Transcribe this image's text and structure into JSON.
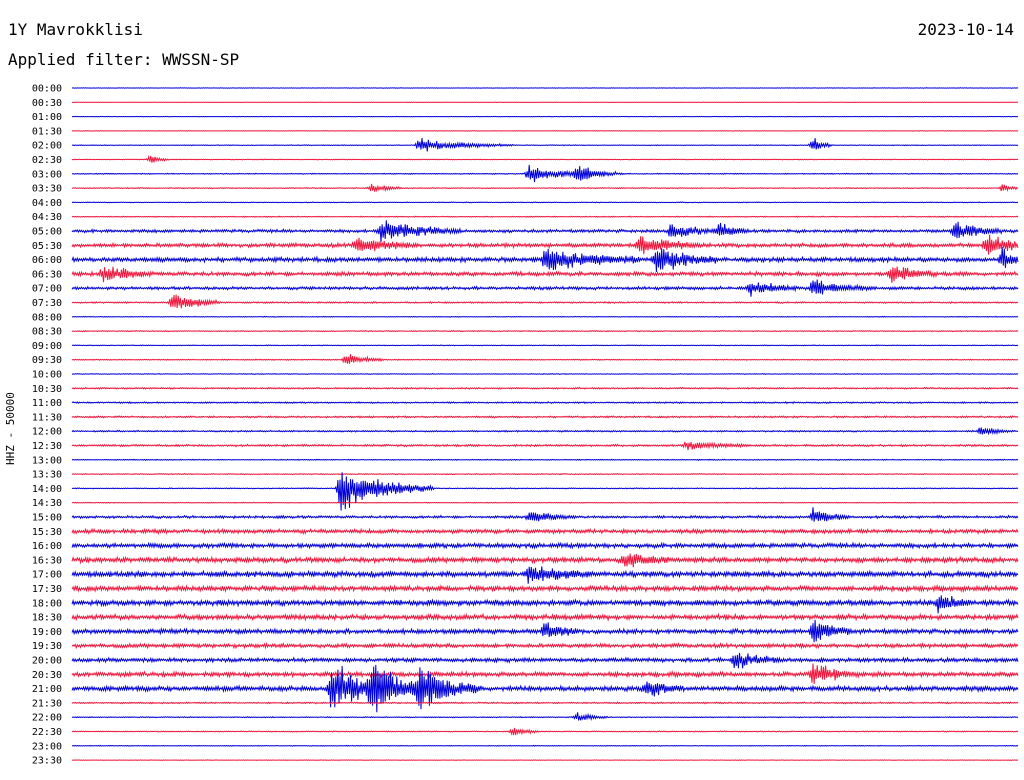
{
  "header": {
    "station": "1Y Mavrokklisi",
    "date": "2023-10-14",
    "filter": "Applied filter: WWSSN-SP"
  },
  "chart_data": {
    "type": "line",
    "title": "1Y Mavrokklisi",
    "ylabel": "HHZ - 50000",
    "trace_times": [
      "00:00",
      "00:30",
      "01:00",
      "01:30",
      "02:00",
      "02:30",
      "03:00",
      "03:30",
      "04:00",
      "04:30",
      "05:00",
      "05:30",
      "06:00",
      "06:30",
      "07:00",
      "07:30",
      "08:00",
      "08:30",
      "09:00",
      "09:30",
      "10:00",
      "10:30",
      "11:00",
      "11:30",
      "12:00",
      "12:30",
      "13:00",
      "13:30",
      "14:00",
      "14:30",
      "15:00",
      "15:30",
      "16:00",
      "16:30",
      "17:00",
      "17:30",
      "18:00",
      "18:30",
      "19:00",
      "19:30",
      "20:00",
      "20:30",
      "21:00",
      "21:30",
      "22:00",
      "22:30",
      "23:00",
      "23:30"
    ],
    "colors": [
      "#0000d8",
      "#f0163c"
    ],
    "noise_level": [
      0.2,
      0.2,
      0.2,
      0.2,
      0.3,
      0.3,
      0.4,
      0.4,
      0.3,
      0.4,
      1.2,
      1.6,
      1.8,
      1.6,
      1.2,
      0.6,
      0.3,
      0.4,
      0.3,
      0.4,
      0.3,
      0.6,
      0.6,
      0.7,
      0.6,
      0.8,
      0.4,
      0.4,
      0.4,
      0.3,
      1.0,
      1.6,
      1.8,
      2.0,
      2.2,
      2.0,
      2.2,
      2.0,
      1.8,
      1.6,
      1.6,
      1.8,
      2.0,
      0.6,
      0.4,
      0.4,
      0.3,
      0.2
    ],
    "events": [
      {
        "trace": "02:00",
        "minute": 11,
        "amplitude": 8,
        "duration": 3
      },
      {
        "trace": "02:00",
        "minute": 23.5,
        "amplitude": 10,
        "duration": 0.6
      },
      {
        "trace": "02:30",
        "minute": 2.5,
        "amplitude": 6,
        "duration": 0.6
      },
      {
        "trace": "03:00",
        "minute": 14.5,
        "amplitude": 12,
        "duration": 2
      },
      {
        "trace": "03:00",
        "minute": 16,
        "amplitude": 10,
        "duration": 1.5
      },
      {
        "trace": "03:30",
        "minute": 9.5,
        "amplitude": 6,
        "duration": 1
      },
      {
        "trace": "03:30",
        "minute": 29.5,
        "amplitude": 6,
        "duration": 0.5
      },
      {
        "trace": "05:00",
        "minute": 9.8,
        "amplitude": 14,
        "duration": 2.5
      },
      {
        "trace": "05:00",
        "minute": 19,
        "amplitude": 10,
        "duration": 1.5
      },
      {
        "trace": "05:00",
        "minute": 20.5,
        "amplitude": 10,
        "duration": 1
      },
      {
        "trace": "05:00",
        "minute": 28,
        "amplitude": 12,
        "duration": 1.5
      },
      {
        "trace": "05:30",
        "minute": 9,
        "amplitude": 10,
        "duration": 2
      },
      {
        "trace": "05:30",
        "minute": 18,
        "amplitude": 12,
        "duration": 2
      },
      {
        "trace": "05:30",
        "minute": 29,
        "amplitude": 12,
        "duration": 1.5
      },
      {
        "trace": "06:00",
        "minute": 15,
        "amplitude": 14,
        "duration": 3
      },
      {
        "trace": "06:00",
        "minute": 18.5,
        "amplitude": 16,
        "duration": 2
      },
      {
        "trace": "06:00",
        "minute": 29.5,
        "amplitude": 12,
        "duration": 1
      },
      {
        "trace": "06:30",
        "minute": 1,
        "amplitude": 10,
        "duration": 1.5
      },
      {
        "trace": "06:30",
        "minute": 26,
        "amplitude": 10,
        "duration": 1.5
      },
      {
        "trace": "07:00",
        "minute": 21.5,
        "amplitude": 12,
        "duration": 1.5
      },
      {
        "trace": "07:00",
        "minute": 23.5,
        "amplitude": 10,
        "duration": 2
      },
      {
        "trace": "07:30",
        "minute": 3.2,
        "amplitude": 12,
        "duration": 1.5
      },
      {
        "trace": "09:30",
        "minute": 8.7,
        "amplitude": 8,
        "duration": 1.2
      },
      {
        "trace": "12:00",
        "minute": 28.8,
        "amplitude": 6,
        "duration": 1
      },
      {
        "trace": "12:30",
        "minute": 19.5,
        "amplitude": 6,
        "duration": 2
      },
      {
        "trace": "14:00",
        "minute": 8.5,
        "amplitude": 26,
        "duration": 3
      },
      {
        "trace": "15:00",
        "minute": 14.5,
        "amplitude": 8,
        "duration": 1.5
      },
      {
        "trace": "15:00",
        "minute": 23.5,
        "amplitude": 10,
        "duration": 1.2
      },
      {
        "trace": "16:30",
        "minute": 17.5,
        "amplitude": 10,
        "duration": 1.5
      },
      {
        "trace": "17:00",
        "minute": 14.5,
        "amplitude": 12,
        "duration": 2
      },
      {
        "trace": "18:00",
        "minute": 27.5,
        "amplitude": 12,
        "duration": 1
      },
      {
        "trace": "19:00",
        "minute": 15,
        "amplitude": 12,
        "duration": 1
      },
      {
        "trace": "19:00",
        "minute": 23.5,
        "amplitude": 16,
        "duration": 1.2
      },
      {
        "trace": "20:00",
        "minute": 21,
        "amplitude": 10,
        "duration": 1.5
      },
      {
        "trace": "20:30",
        "minute": 23.5,
        "amplitude": 14,
        "duration": 1.5
      },
      {
        "trace": "21:00",
        "minute": 8.2,
        "amplitude": 30,
        "duration": 2
      },
      {
        "trace": "21:00",
        "minute": 9.5,
        "amplitude": 28,
        "duration": 2.5
      },
      {
        "trace": "21:00",
        "minute": 11,
        "amplitude": 22,
        "duration": 2
      },
      {
        "trace": "21:00",
        "minute": 18.2,
        "amplitude": 12,
        "duration": 1.2
      },
      {
        "trace": "22:00",
        "minute": 16,
        "amplitude": 6,
        "duration": 1
      },
      {
        "trace": "22:30",
        "minute": 14,
        "amplitude": 6,
        "duration": 0.8
      }
    ]
  }
}
